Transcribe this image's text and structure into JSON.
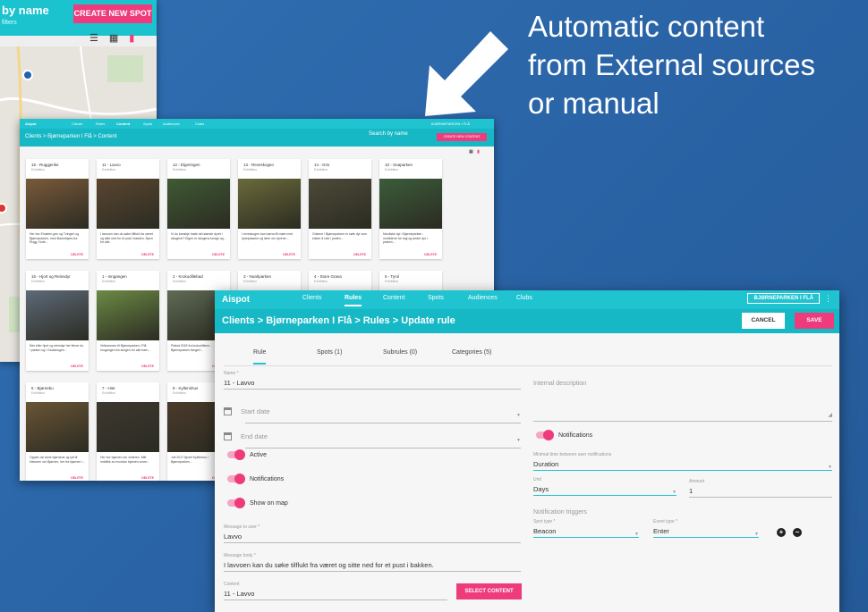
{
  "annotation": {
    "lines": [
      "Automatic content",
      "from External sources",
      "or manual"
    ]
  },
  "window_spots": {
    "title": "by name",
    "subtitle": "filters",
    "create_button": "CREATE NEW SPOT"
  },
  "window_content": {
    "brand": "Aispot",
    "nav": [
      "Clients",
      "Rules",
      "Content",
      "Spots",
      "Audiences",
      "Clubs"
    ],
    "account": "BJØRNEPARKEN I FLÅ",
    "breadcrumb": "Clients  >  Bjørneparken I Flå  >  Content",
    "search": "Search by name",
    "create_button": "CREATE NEW CONTENT",
    "cards": [
      {
        "title": "15 - Ruggjerike",
        "sub": "Exhibition",
        "text": "Her bor Einstein-gen og Tvingen og Bjørneparken, med Barnebjørn-fra Rugg, Note...",
        "del": "DELETE",
        "color": "#7a5a3a"
      },
      {
        "title": "11 - Lavvo",
        "sub": "Exhibition",
        "text": "I lavvoen kan du søke tilflukt fra været og sitte ned for et pust i bakken. Åpen for alle.",
        "del": "DELETE",
        "color": "#5a4630"
      },
      {
        "title": "12 - Elgeringen",
        "sub": "Exhibition",
        "text": "Vi du kanskje møte det største dyret i skogene? Elgen er skogens konge og...",
        "del": "DELETE",
        "color": "#3f5a35"
      },
      {
        "title": "13 - Reveskogen",
        "sub": "Exhibition",
        "text": "I reveskogen kan barna få møte med dyrepassere og lære om dyrene...",
        "del": "DELETE",
        "color": "#6a6a3a"
      },
      {
        "title": "14 - Gris",
        "sub": "Exhibition",
        "text": "Grisene i Bjørneparken er søte dyr som elsker å rote i jorden...",
        "del": "DELETE",
        "color": "#4d4a38"
      },
      {
        "title": "10 - Snøparken",
        "sub": "Exhibition",
        "text": "Nordiske dyr i Bjørneparken - områdene for fugl og andre dyr i parken...",
        "del": "DELETE",
        "color": "#3c5c3a"
      },
      {
        "title": "16 - Hjort og Reinsdyr",
        "sub": "Exhibition",
        "text": "Mer eller hjort og reinsdyr her finner du i parken og i Gaulskogen...",
        "del": "DELETE",
        "color": "#5d6a78"
      },
      {
        "title": "1 - Inngangen",
        "sub": "Exhibition",
        "text": "Velkommen til Bjørneparken i Flå. Inngangen fra skogen for alle barn...",
        "del": "DELETE",
        "color": "#6c8a45"
      },
      {
        "title": "2 - Krokodillebad",
        "sub": "Exhibition",
        "text": "Plakat 2015 fra krokodillene - Bjørneparken fanget i...",
        "del": "DELETE",
        "color": "#5f6b55"
      },
      {
        "title": "3 - Noahparken",
        "sub": "Exhibition",
        "text": "",
        "del": "DELETE",
        "color": "#8a9aa5"
      },
      {
        "title": "4 - Store Grava",
        "sub": "Exhibition",
        "text": "",
        "del": "DELETE",
        "color": "#8a9aa5"
      },
      {
        "title": "5 - Tyrol",
        "sub": "Exhibition",
        "text": "",
        "del": "DELETE",
        "color": "#8a9aa5"
      },
      {
        "title": "6 - Bjørnebu",
        "sub": "Exhibition",
        "text": "Opplev de store bjørnene og lytt til historien om Bjørnen, her fra bjørnen i...",
        "del": "DELETE",
        "color": "#6a5535"
      },
      {
        "title": "7 - Hiet",
        "sub": "Exhibition",
        "text": "Her bor bjørnen om vinteren. Mitt innblikk av hvordan bjørnen sover...",
        "del": "DELETE",
        "color": "#3d3830"
      },
      {
        "title": "8 - Kyllenshus",
        "sub": "Exhibition",
        "text": "Juli 2017 åpnet Kyllenhus i Bjørneparken...",
        "del": "DELETE",
        "color": "#4a3a2a"
      }
    ]
  },
  "window_rule": {
    "brand": "Aispot",
    "nav": [
      "Clients",
      "Rules",
      "Content",
      "Spots",
      "Audiences",
      "Clubs"
    ],
    "account": "BJØRNEPARKEN I FLÅ",
    "breadcrumb": "Clients  >  Bjørneparken I Flå  >  Rules  >  Update rule",
    "cancel": "CANCEL",
    "save": "SAVE",
    "tabs": [
      "Rule",
      "Spots (1)",
      "Subrules (0)",
      "Categories (5)"
    ],
    "name_label": "Name *",
    "name_value": "11 - Lavvo",
    "start_date": "Start date",
    "end_date": "End date",
    "active_label": "Active",
    "notifications_label": "Notifications",
    "show_on_map_label": "Show on map",
    "message_label": "Message to user *",
    "message_value": "Lavvo",
    "body_label": "Message body *",
    "body_value": "I lavvoen kan du søke tilflukt fra været og sitte ned for et pust i bakken.",
    "content_label": "Content",
    "content_value": "11 - Lavvo",
    "select_content": "SELECT CONTENT",
    "internal_description": "Internal description",
    "notifications_right": "Notifications",
    "minimal_time_label": "Minimal time between user notifications",
    "minimal_time_value": "Duration",
    "unit_label": "Unit",
    "unit_value": "Days",
    "amount_label": "Amount",
    "amount_value": "1",
    "triggers_title": "Notification triggers",
    "spot_type_label": "Spot type *",
    "spot_type_value": "Beacon",
    "event_type_label": "Event type *",
    "event_type_value": "Enter",
    "add_symbol": "+",
    "remove_symbol": "−"
  }
}
